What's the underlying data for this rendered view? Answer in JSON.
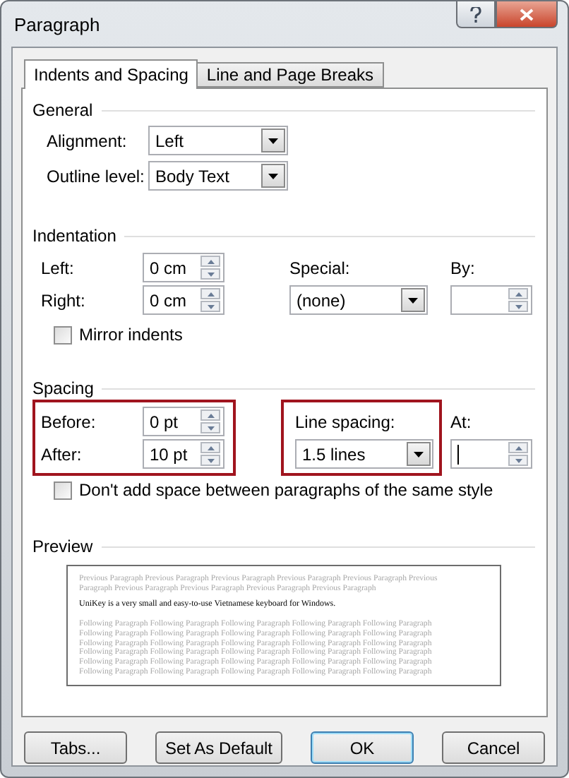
{
  "window": {
    "title": "Paragraph"
  },
  "tabs": [
    {
      "label": "Indents and Spacing",
      "selected": true
    },
    {
      "label": "Line and Page Breaks",
      "selected": false
    }
  ],
  "general": {
    "heading": "General",
    "fields": [
      {
        "label": "Alignment:",
        "value": "Left"
      },
      {
        "label": "Outline level:",
        "value": "Body Text"
      }
    ]
  },
  "indentation": {
    "heading": "Indentation",
    "left": {
      "label": "Left:",
      "value": "0 cm"
    },
    "right": {
      "label": "Right:",
      "value": "0 cm"
    },
    "special": {
      "label": "Special:",
      "value": "(none)"
    },
    "by": {
      "label": "By:"
    },
    "mirror": {
      "label": "Mirror indents",
      "checked": false
    }
  },
  "spacing": {
    "heading": "Spacing",
    "before_after": {
      "highlighted": true,
      "before": {
        "label": "Before:",
        "value": "0 pt"
      },
      "after": {
        "label": "After:",
        "value": "10 pt"
      }
    },
    "line_spacing": {
      "highlighted": true,
      "label": "Line spacing:",
      "value": "1.5 lines"
    },
    "at": {
      "label": "At:",
      "focused": true
    },
    "dont_add": {
      "label": "Don't add space between paragraphs of the same style",
      "checked": false
    }
  },
  "preview": {
    "heading": "Preview",
    "previous_lines": [
      "Previous Paragraph Previous Paragraph Previous Paragraph Previous Paragraph Previous Paragraph Previous",
      "Paragraph Previous Paragraph Previous Paragraph Previous Paragraph Previous Paragraph"
    ],
    "sample": "UniKey is a very small and easy-to-use Vietnamese keyboard for Windows.",
    "following_lines": [
      "Following Paragraph Following Paragraph Following Paragraph Following Paragraph Following Paragraph",
      "Following Paragraph Following Paragraph Following Paragraph Following Paragraph Following Paragraph",
      "Following Paragraph Following Paragraph Following Paragraph Following Paragraph Following Paragraph",
      "Following Paragraph Following Paragraph Following Paragraph Following Paragraph Following Paragraph",
      "Following Paragraph Following Paragraph Following Paragraph Following Paragraph Following Paragraph",
      "Following Paragraph Following Paragraph Following Paragraph Following Paragraph Following Paragraph"
    ]
  },
  "buttons": [
    {
      "label": "Tabs...",
      "default": false
    },
    {
      "label": "Set As Default",
      "default": false
    },
    {
      "label": "OK",
      "default": true
    },
    {
      "label": "Cancel",
      "default": false
    }
  ]
}
